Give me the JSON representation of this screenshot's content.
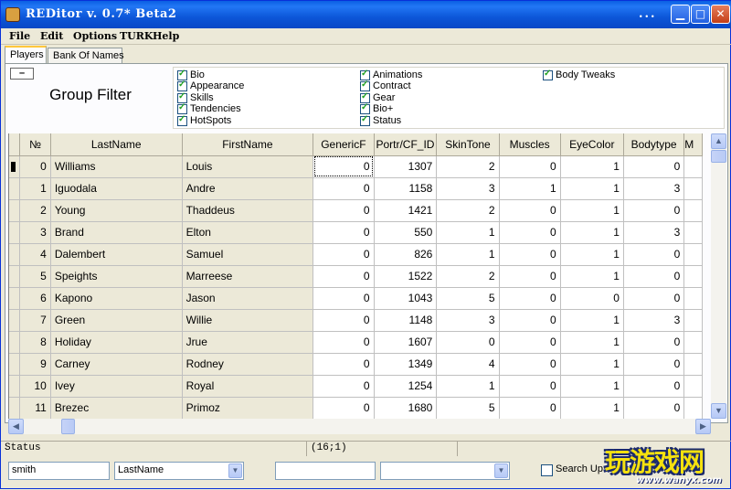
{
  "window": {
    "title": "REDitor v. 0.7*  Beta2",
    "dots": "..."
  },
  "menu": [
    "File",
    "Edit",
    "Options",
    "TURK",
    "Help"
  ],
  "tabs": [
    {
      "label": "Players",
      "active": true
    },
    {
      "label": "Bank Of Names",
      "active": false
    }
  ],
  "collapse_label": "–",
  "group_filter": {
    "title": "Group Filter",
    "columns": [
      [
        {
          "label": "Bio",
          "checked": true
        },
        {
          "label": "Appearance",
          "checked": true
        },
        {
          "label": "Skills",
          "checked": true
        },
        {
          "label": "Tendencies",
          "checked": true
        },
        {
          "label": "HotSpots",
          "checked": true
        }
      ],
      [
        {
          "label": "Animations",
          "checked": true
        },
        {
          "label": "Contract",
          "checked": true
        },
        {
          "label": "Gear",
          "checked": true
        },
        {
          "label": "Bio+",
          "checked": true
        },
        {
          "label": "Status",
          "checked": true
        }
      ],
      [
        {
          "label": "Body Tweaks",
          "checked": true
        }
      ]
    ]
  },
  "grid": {
    "columns": [
      "№",
      "LastName",
      "FirstName",
      "GenericF",
      "Portr/CF_ID",
      "SkinTone",
      "Muscles",
      "EyeColor",
      "Bodytype",
      "M"
    ],
    "rows": [
      [
        "0",
        "Williams",
        "Louis",
        "0",
        "1307",
        "2",
        "0",
        "1",
        "0"
      ],
      [
        "1",
        "Iguodala",
        "Andre",
        "0",
        "1158",
        "3",
        "1",
        "1",
        "3"
      ],
      [
        "2",
        "Young",
        "Thaddeus",
        "0",
        "1421",
        "2",
        "0",
        "1",
        "0"
      ],
      [
        "3",
        "Brand",
        "Elton",
        "0",
        "550",
        "1",
        "0",
        "1",
        "3"
      ],
      [
        "4",
        "Dalembert",
        "Samuel",
        "0",
        "826",
        "1",
        "0",
        "1",
        "0"
      ],
      [
        "5",
        "Speights",
        "Marreese",
        "0",
        "1522",
        "2",
        "0",
        "1",
        "0"
      ],
      [
        "6",
        "Kapono",
        "Jason",
        "0",
        "1043",
        "5",
        "0",
        "0",
        "0"
      ],
      [
        "7",
        "Green",
        "Willie",
        "0",
        "1148",
        "3",
        "0",
        "1",
        "3"
      ],
      [
        "8",
        "Holiday",
        "Jrue",
        "0",
        "1607",
        "0",
        "0",
        "1",
        "0"
      ],
      [
        "9",
        "Carney",
        "Rodney",
        "0",
        "1349",
        "4",
        "0",
        "1",
        "0"
      ],
      [
        "10",
        "Ivey",
        "Royal",
        "0",
        "1254",
        "1",
        "0",
        "1",
        "0"
      ],
      [
        "11",
        "Brezec",
        "Primoz",
        "0",
        "1680",
        "5",
        "0",
        "1",
        "0"
      ]
    ]
  },
  "status": {
    "label": "Status",
    "position": "(16;1)"
  },
  "search": {
    "text": "smith",
    "field": "LastName",
    "value2": "",
    "field2": "",
    "search_up_label": "Search Up",
    "search_up_checked": false
  },
  "watermark": {
    "text": "玩游戏网",
    "url": "www.wanyx.com"
  }
}
